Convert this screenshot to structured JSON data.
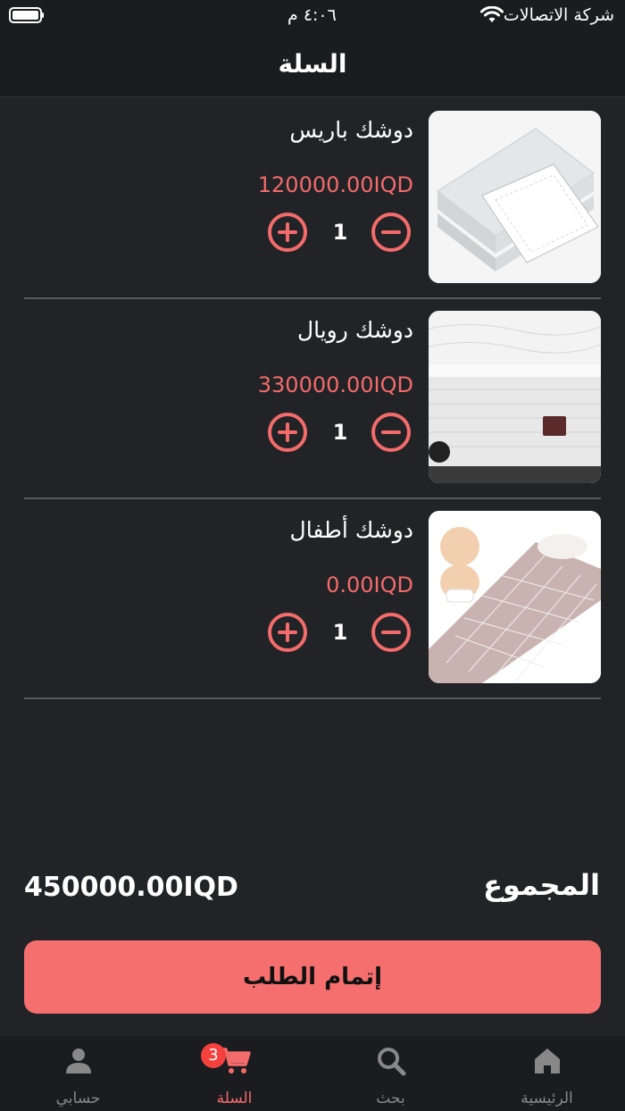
{
  "status_bar": {
    "carrier": "شركة الاتصالات",
    "time": "٤:٠٦ م"
  },
  "header": {
    "title": "السلة"
  },
  "cart": {
    "items": [
      {
        "name": "دوشك باريس",
        "price": "120000.00IQD",
        "quantity": "1"
      },
      {
        "name": "دوشك رويال",
        "price": "330000.00IQD",
        "quantity": "1"
      },
      {
        "name": "دوشك أطفال",
        "price": "0.00IQD",
        "quantity": "1"
      }
    ]
  },
  "summary": {
    "total_label": "المجموع",
    "total_value": "450000.00IQD"
  },
  "checkout": {
    "label": "إتمام الطلب"
  },
  "tabbar": {
    "home": "الرئيسية",
    "search": "بحث",
    "cart": "السلة",
    "cart_badge": "3",
    "account": "حسابي"
  },
  "colors": {
    "accent": "#f66f6f",
    "price": "#f36b6b",
    "background": "#222326",
    "badge": "#f5413d"
  }
}
